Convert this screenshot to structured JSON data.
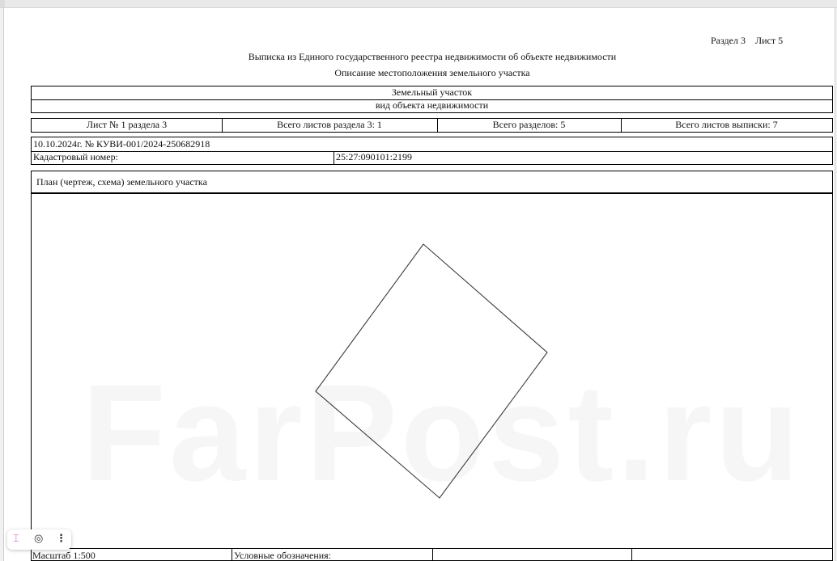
{
  "header": {
    "section_label": "Раздел 3",
    "sheet_label": "Лист 5",
    "title": "Выписка из Единого государственного реестра недвижимости об объекте недвижимости",
    "subtitle": "Описание местоположения земельного участка"
  },
  "object": {
    "type": "Земельный участок",
    "type_caption": "вид объекта недвижимости"
  },
  "sheets_row": [
    "Лист № 1 раздела 3",
    "Всего листов раздела 3: 1",
    "Всего разделов: 5",
    "Всего листов выписки: 7"
  ],
  "extract_ref": "10.10.2024г. № КУВИ-001/2024-250682918",
  "cadastral": {
    "label": "Кадастровый номер:",
    "value": "25:27:090101:2199"
  },
  "plan": {
    "caption": "План (чертеж, схема) земельного участка"
  },
  "footer": {
    "scale": "Масштаб 1:500",
    "legend_label": "Условные обозначения:"
  },
  "watermark": "FarPost.ru",
  "toolbar_icons": [
    "text-select-icon",
    "camera-icon",
    "more-vertical-icon"
  ]
}
